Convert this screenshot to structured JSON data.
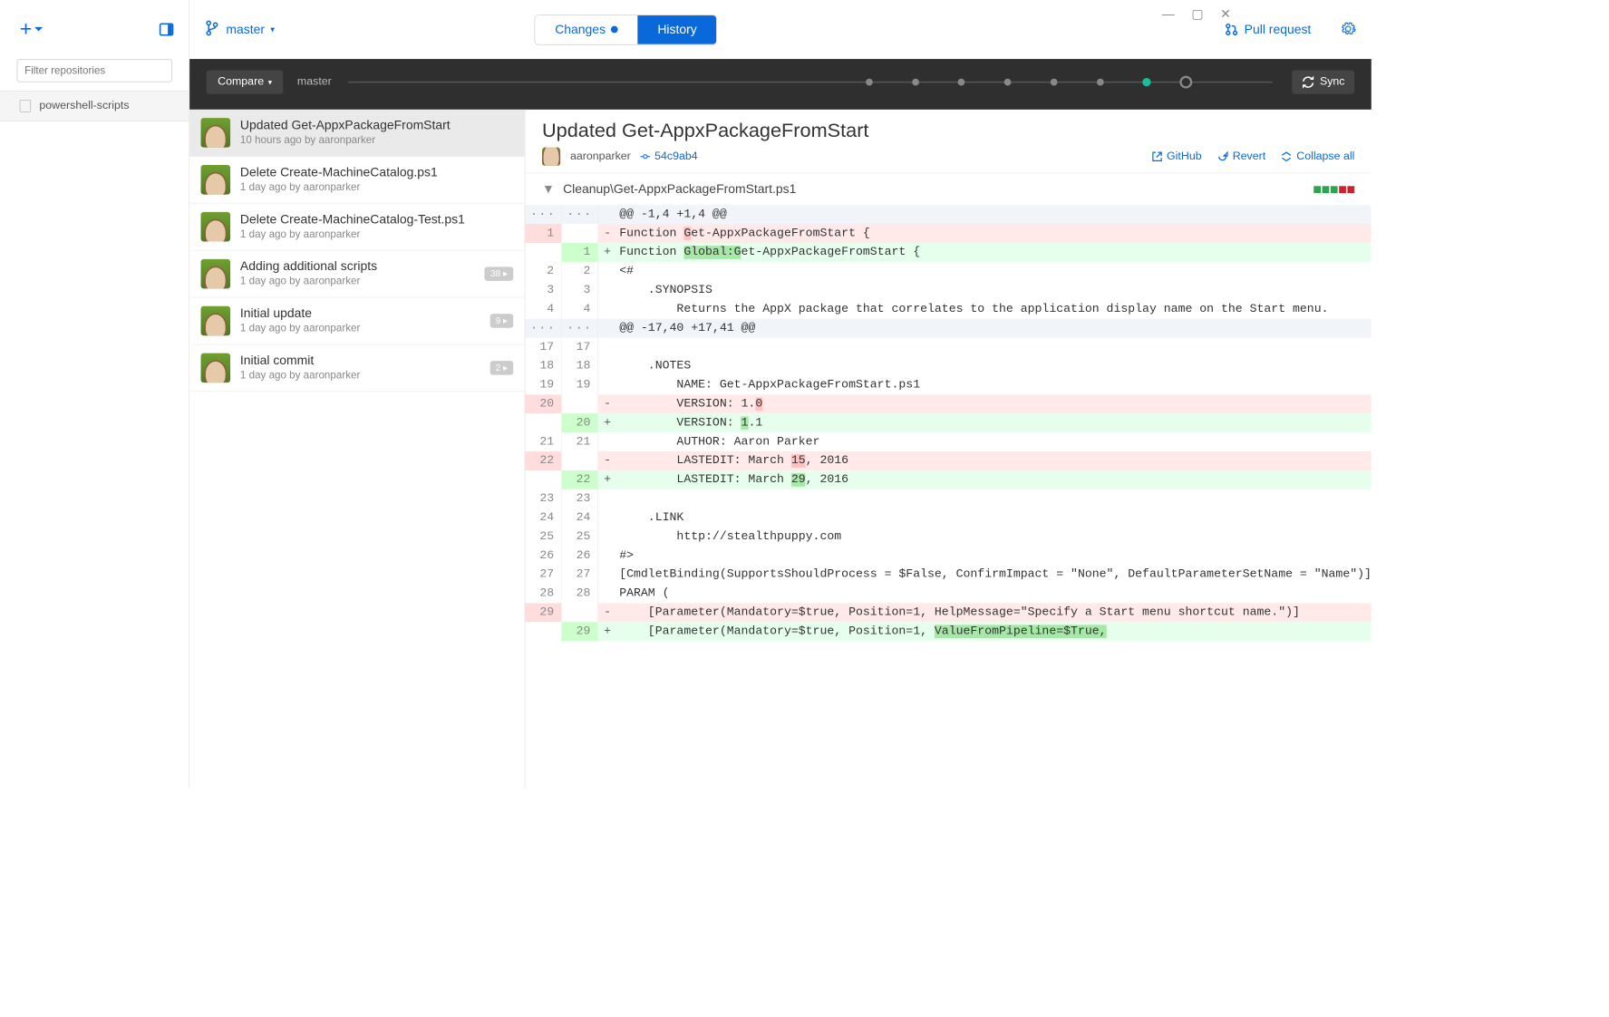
{
  "window": {
    "minimize": "—",
    "maximize": "▢",
    "close": "✕"
  },
  "sidebar": {
    "filter_placeholder": "Filter repositories",
    "repos": [
      {
        "name": "powershell-scripts"
      }
    ]
  },
  "toolbar": {
    "branch": "master",
    "tabs": {
      "changes": "Changes",
      "history": "History"
    },
    "pull_request": "Pull request"
  },
  "branch_bar": {
    "compare": "Compare",
    "branch_label": "master",
    "sync": "Sync",
    "node_positions_pct": [
      56,
      61,
      66,
      71,
      76,
      81,
      86
    ]
  },
  "commits": [
    {
      "title": "Updated Get-AppxPackageFromStart",
      "meta": "10 hours ago by aaronparker",
      "selected": true
    },
    {
      "title": "Delete Create-MachineCatalog.ps1",
      "meta": "1 day ago by aaronparker"
    },
    {
      "title": "Delete Create-MachineCatalog-Test.ps1",
      "meta": "1 day ago by aaronparker"
    },
    {
      "title": "Adding additional scripts",
      "meta": "1 day ago by aaronparker",
      "badge": "38 ▸"
    },
    {
      "title": "Initial update",
      "meta": "1 day ago by aaronparker",
      "badge": "9 ▸"
    },
    {
      "title": "Initial commit",
      "meta": "1 day ago by aaronparker",
      "badge": "2 ▸"
    }
  ],
  "diff": {
    "title": "Updated Get-AppxPackageFromStart",
    "author": "aaronparker",
    "sha": "54c9ab4",
    "actions": {
      "github": "GitHub",
      "revert": "Revert",
      "collapse": "Collapse all"
    },
    "file": "Cleanup\\Get-AppxPackageFromStart.ps1",
    "rows": [
      {
        "type": "hunk",
        "oldLn": "···",
        "newLn": "···",
        "sign": "",
        "text": "@@ -1,4 +1,4 @@"
      },
      {
        "type": "del",
        "oldLn": "1",
        "newLn": "",
        "sign": "-",
        "text": "Function Get-AppxPackageFromStart {",
        "hl": [
          "G"
        ]
      },
      {
        "type": "add",
        "oldLn": "",
        "newLn": "1",
        "sign": "+",
        "text": "Function Global:Get-AppxPackageFromStart {",
        "hl": [
          "Global:G"
        ]
      },
      {
        "type": "ctx",
        "oldLn": "2",
        "newLn": "2",
        "sign": "",
        "text": "<#"
      },
      {
        "type": "ctx",
        "oldLn": "3",
        "newLn": "3",
        "sign": "",
        "text": "    .SYNOPSIS"
      },
      {
        "type": "ctx",
        "oldLn": "4",
        "newLn": "4",
        "sign": "",
        "text": "        Returns the AppX package that correlates to the application display name on the Start menu."
      },
      {
        "type": "hunk",
        "oldLn": "···",
        "newLn": "···",
        "sign": "",
        "text": "@@ -17,40 +17,41 @@"
      },
      {
        "type": "ctx",
        "oldLn": "17",
        "newLn": "17",
        "sign": "",
        "text": ""
      },
      {
        "type": "ctx",
        "oldLn": "18",
        "newLn": "18",
        "sign": "",
        "text": "    .NOTES"
      },
      {
        "type": "ctx",
        "oldLn": "19",
        "newLn": "19",
        "sign": "",
        "text": "        NAME: Get-AppxPackageFromStart.ps1"
      },
      {
        "type": "del",
        "oldLn": "20",
        "newLn": "",
        "sign": "-",
        "text": "        VERSION: 1.0",
        "hl": [
          "0"
        ]
      },
      {
        "type": "add",
        "oldLn": "",
        "newLn": "20",
        "sign": "+",
        "text": "        VERSION: 1.1",
        "hl": [
          "1"
        ]
      },
      {
        "type": "ctx",
        "oldLn": "21",
        "newLn": "21",
        "sign": "",
        "text": "        AUTHOR: Aaron Parker"
      },
      {
        "type": "del",
        "oldLn": "22",
        "newLn": "",
        "sign": "-",
        "text": "        LASTEDIT: March 15, 2016",
        "hl": [
          "15"
        ]
      },
      {
        "type": "add",
        "oldLn": "",
        "newLn": "22",
        "sign": "+",
        "text": "        LASTEDIT: March 29, 2016",
        "hl": [
          "29"
        ]
      },
      {
        "type": "ctx",
        "oldLn": "23",
        "newLn": "23",
        "sign": "",
        "text": ""
      },
      {
        "type": "ctx",
        "oldLn": "24",
        "newLn": "24",
        "sign": "",
        "text": "    .LINK"
      },
      {
        "type": "ctx",
        "oldLn": "25",
        "newLn": "25",
        "sign": "",
        "text": "        http://stealthpuppy.com"
      },
      {
        "type": "ctx",
        "oldLn": "26",
        "newLn": "26",
        "sign": "",
        "text": "#>"
      },
      {
        "type": "ctx",
        "oldLn": "27",
        "newLn": "27",
        "sign": "",
        "text": "[CmdletBinding(SupportsShouldProcess = $False, ConfirmImpact = \"None\", DefaultParameterSetName = \"Name\")]"
      },
      {
        "type": "ctx",
        "oldLn": "28",
        "newLn": "28",
        "sign": "",
        "text": "PARAM ("
      },
      {
        "type": "del",
        "oldLn": "29",
        "newLn": "",
        "sign": "-",
        "text": "    [Parameter(Mandatory=$true, Position=1, HelpMessage=\"Specify a Start menu shortcut name.\")]"
      },
      {
        "type": "add",
        "oldLn": "",
        "newLn": "29",
        "sign": "+",
        "text": "    [Parameter(Mandatory=$true, Position=1, ValueFromPipeline=$True,",
        "hl": [
          "ValueFromPipeline=$True,"
        ]
      }
    ]
  }
}
